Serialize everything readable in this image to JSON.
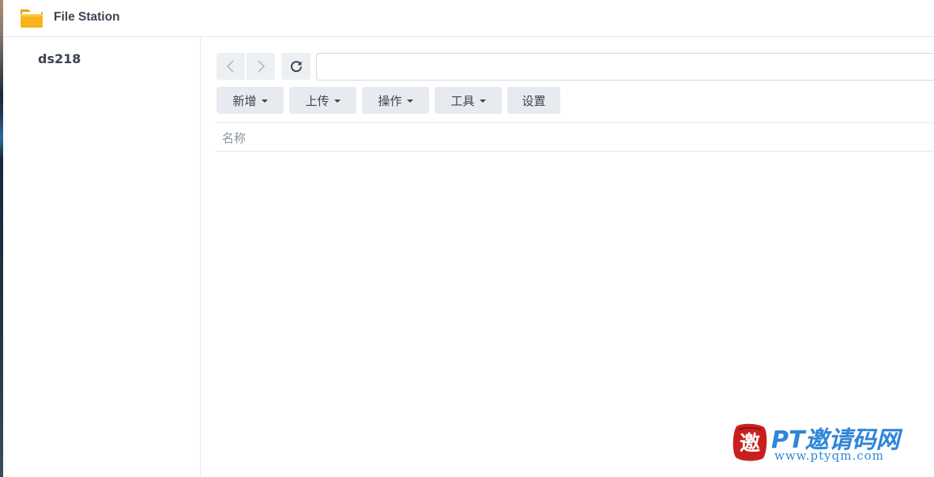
{
  "window": {
    "title": "File Station",
    "app_icon": "folder-icon"
  },
  "sidebar": {
    "items": [
      {
        "label": "ds218"
      }
    ]
  },
  "navigation": {
    "back_icon": "chevron-left-icon",
    "forward_icon": "chevron-right-icon",
    "refresh_icon": "refresh-icon",
    "path_value": ""
  },
  "toolbar": {
    "buttons": [
      {
        "label": "新增",
        "has_dropdown": true
      },
      {
        "label": "上传",
        "has_dropdown": true
      },
      {
        "label": "操作",
        "has_dropdown": true
      },
      {
        "label": "工具",
        "has_dropdown": true
      },
      {
        "label": "设置",
        "has_dropdown": false
      }
    ]
  },
  "file_list": {
    "columns": [
      {
        "label": "名称"
      }
    ],
    "rows": []
  },
  "watermark": {
    "seal_char": "邀",
    "title": "PT邀请码网",
    "url": "www.ptyqm.com"
  },
  "colors": {
    "accent": "#2f86d9",
    "button_bg": "#e7ebef",
    "text": "#3b4451",
    "seal_red": "#c8201e"
  }
}
